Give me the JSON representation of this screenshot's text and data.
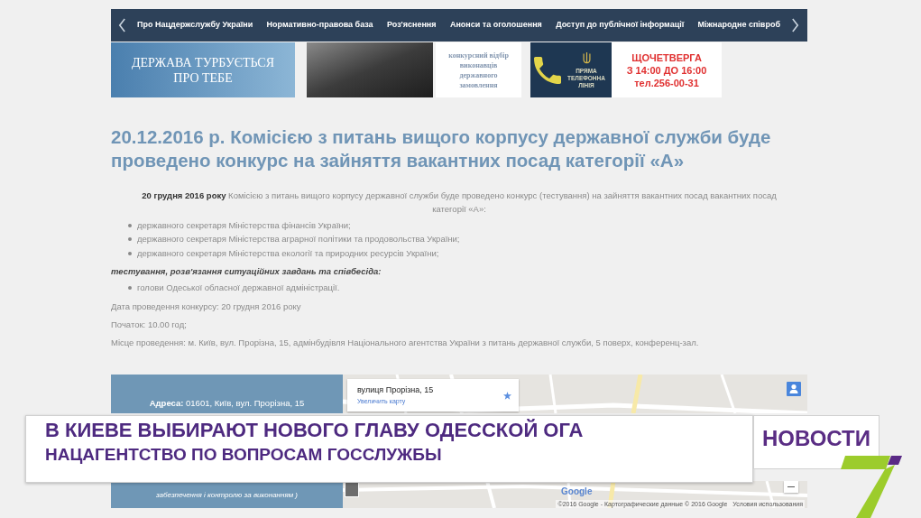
{
  "nav": {
    "items": [
      {
        "label": "Про Нацдержслужбу України"
      },
      {
        "label": "Нормативно-правова база"
      },
      {
        "label": "Роз'яснення"
      },
      {
        "label": "Анонси та оголошення"
      },
      {
        "label": "Доступ до публічної інформації"
      },
      {
        "label": "Міжнародне співроб"
      }
    ]
  },
  "banners": [
    {
      "kind": "slogan",
      "lines": [
        "ДЕРЖАВА ТУРБУЄТЬСЯ",
        "ПРО ТЕБЕ"
      ]
    },
    {
      "kind": "photo"
    },
    {
      "kind": "notice",
      "lines": [
        "конкурсний відбір",
        "виконавців",
        "державного",
        "замовлення"
      ]
    },
    {
      "kind": "hotline",
      "lines": [
        "ПРЯМА",
        "ТЕЛЕФОННА",
        "ЛІНІЯ"
      ]
    },
    {
      "kind": "schedule",
      "lines": [
        "ЩОЧЕТВЕРГА",
        "З 14:00 ДО 16:00",
        "тел.256-00-31"
      ]
    }
  ],
  "article": {
    "title": "20.12.2016 р. Комісією з питань вищого корпусу державної служби буде проведено конкурс на зайняття вакантних посад категорії «А»",
    "intro": "**20 грудня 2016 року** Комісією з питань вищого корпусу державної служби буде проведено конкурс (тестування) на зайняття вакантних посад вакантних посад категорії «А»:",
    "positions_testing": [
      "державного секретаря Міністерства фінансів України;",
      "державного секретаря Міністерства аграрної політики та продовольства України;",
      "державного секретаря Міністерства екології та природних ресурсів України;"
    ],
    "subheading": "тестування, розв'язання ситуаційних завдань та співбесіда:",
    "positions_full": [
      "голови Одеської обласної державної адміністрації."
    ],
    "details": [
      "Дата проведення конкурсу: 20 грудня 2016 року",
      "Початок: 10.00 год;",
      "Місце проведення: м. Київ, вул. Прорізна, 15, адмінбудівля Національного агентства України з питань державної служби, 5 поверх, конференц-зал."
    ]
  },
  "contact": {
    "address": "**Адреса:** 01601, Київ, вул. Прорізна, 15",
    "note": "забезпечення і контролю за виконанням )"
  },
  "map": {
    "place_card": {
      "title": "вулиця Прорізна, 15",
      "link": "Увеличить карту"
    },
    "logo": "Google",
    "attribution": "©2016 Google - Картографические данные © 2016 Google",
    "terms": "Условия использования"
  },
  "news_caption": {
    "headline": "В КИЕВЕ ВЫБИРАЮТ НОВОГО ГЛАВУ ОДЕССКОЙ ОГА",
    "subheadline": "НАЦАГЕНТСТВО ПО ВОПРОСАМ ГОССЛУЖБЫ",
    "section": "НОВОСТИ"
  }
}
